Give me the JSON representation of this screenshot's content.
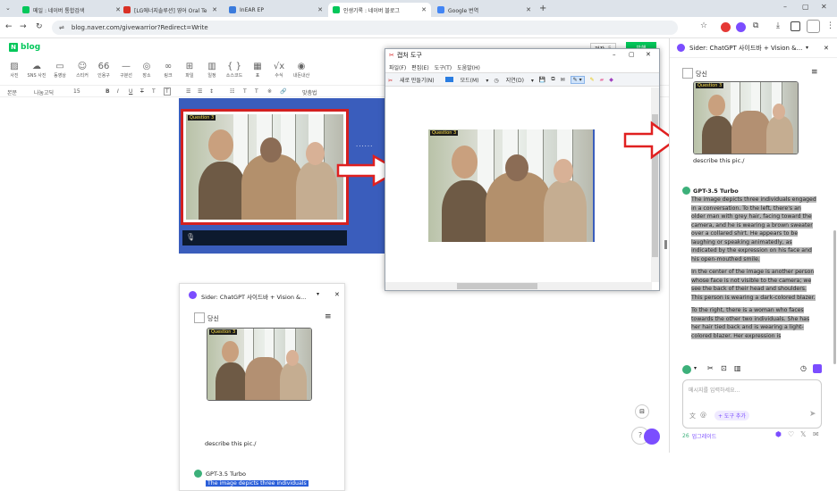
{
  "tabs": [
    {
      "title": "메일 : 네이버 통합검색",
      "color": "#03c75a"
    },
    {
      "title": "[LG에너지솔루션] 영어 Oral Te",
      "color": "#d93025"
    },
    {
      "title": "InEAR EP",
      "color": "#3b7bdc"
    },
    {
      "title": "인생기록 : 네이버 블로그",
      "color": "#03c75a",
      "active": true
    },
    {
      "title": "Google 번역",
      "color": "#4285f4"
    }
  ],
  "new_tab": "+",
  "window_controls": {
    "minimize": "–",
    "maximize": "▢",
    "close": "✕"
  },
  "url": "blog.naver.com/givewarrior?Redirect=Write",
  "editor": {
    "logo_text": "blog",
    "logo_letter": "N",
    "save_label": "저장",
    "save_count": "5",
    "publish_label": "발행",
    "tools": [
      "사진",
      "SNS 사진",
      "동영상",
      "스티커",
      "인용구",
      "구분선",
      "장소",
      "링크",
      "파일",
      "일정",
      "소스코드",
      "표",
      "수식",
      "내돈내산"
    ],
    "tool_icons": [
      "▨",
      "☁",
      "▭",
      "☺",
      "66",
      "—",
      "◎",
      "∞",
      "⊞",
      "▥",
      "{ }",
      "▦",
      "√x",
      "◉"
    ],
    "format": {
      "paragraph": "본문",
      "font": "나눔고딕",
      "size": "15",
      "bold": "B",
      "italic": "I",
      "underline": "U",
      "strike": "T",
      "textcolor": "T",
      "bgcolor": "T",
      "align_left": "☰",
      "align_center": "☰",
      "linespacing": "↕",
      "list": "☷",
      "sup": "T",
      "sub": "T",
      "special": "※",
      "link": "🔗",
      "spellcheck": "맞춤법"
    },
    "question_label": "Question 3",
    "dots": "......",
    "mic": "🎙"
  },
  "capture": {
    "title": "캡처 도구",
    "menu": [
      "파일(F)",
      "편집(E)",
      "도구(T)",
      "도움말(H)"
    ],
    "toolbar": {
      "new": "새로 만들기(N)",
      "mode": "모드(M)",
      "delay": "지연(D)"
    },
    "question_label": "Question 3"
  },
  "sider": {
    "header": "Sider: ChatGPT 사이드바 + Vision &...",
    "user_label": "당신",
    "question_label": "Question 3",
    "prompt": "describe this pic./",
    "model": "GPT-3.5 Turbo",
    "answer_paragraphs": [
      "The image depicts three individuals engaged in a conversation. To the left, there's an older man with grey hair, facing toward the camera, and he is wearing a brown sweater over a collared shirt. He appears to be laughing or speaking animatedly, as indicated by the expression on his face and his open-mouthed smile.",
      "In the center of the image is another person whose face is not visible to the camera; we see the back of their head and shoulders. This person is wearing a dark-colored blazer.",
      "To the right, there is a woman who faces towards the other two individuals. She has her hair tied back and is wearing a light-colored blazer. Her expression is"
    ],
    "input_placeholder": "메시지를 입력하세요...",
    "tools_add": "+ 도구 추가",
    "upgrade_count": "26",
    "upgrade_label": "업그레이드"
  },
  "mini_sider": {
    "header": "Sider: ChatGPT 사이드바 + Vision &...",
    "user_label": "당신",
    "question_label": "Question 3",
    "prompt": "describe this pic./",
    "model": "GPT-3.5 Turbo",
    "answer_start": "The image depicts three individuals"
  },
  "colors": {
    "naver_green": "#03c75a",
    "blue_band": "#3a5dbc",
    "red_frame": "#d32020",
    "sider_purple": "#7b4dff"
  }
}
